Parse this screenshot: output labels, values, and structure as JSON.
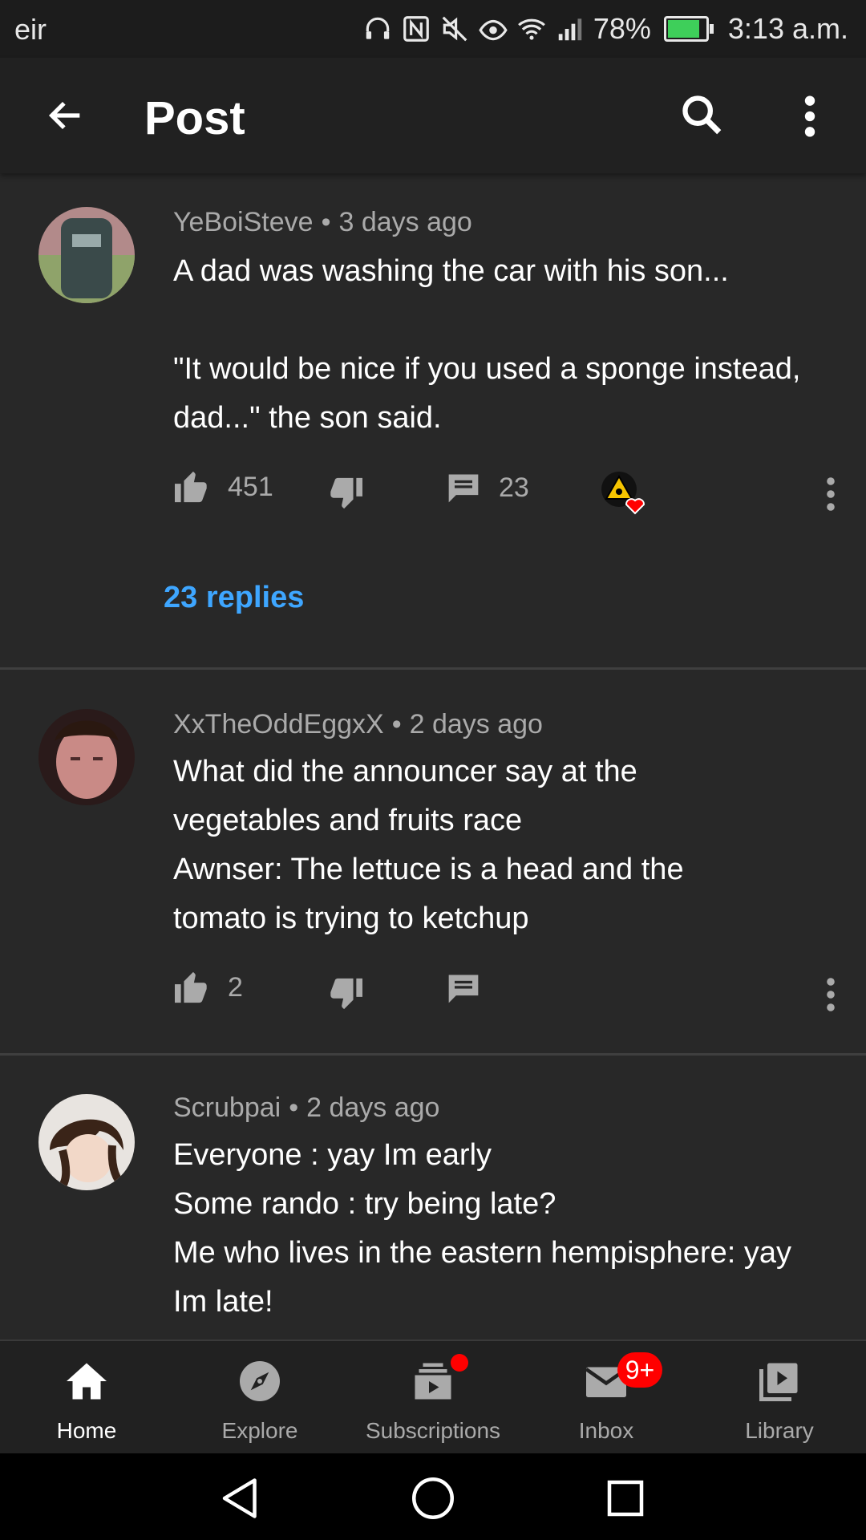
{
  "status_bar": {
    "carrier": "eir",
    "battery": "78%",
    "time": "3:13 a.m.",
    "icons": [
      "headphones-icon",
      "nfc-icon",
      "mute-icon",
      "eye-icon",
      "wifi-icon",
      "signal-icon",
      "battery-icon"
    ]
  },
  "app_bar": {
    "title": "Post",
    "icons": [
      "back-arrow-icon",
      "search-icon",
      "more-vert-icon"
    ]
  },
  "comments": [
    {
      "author": "YeBoiSteve",
      "sep": "•",
      "time": "3 days ago",
      "text": "A dad was washing the car with his son...\n\n\"It would be nice if you used a sponge instead, dad...\" the son said.",
      "likes": "451",
      "replies_count": "23",
      "replies_link": "23 replies"
    },
    {
      "author": "XxTheOddEggxX",
      "sep": "•",
      "time": "2 days ago",
      "text": "What did the announcer say at the vegetables and fruits race\nAwnser: The lettuce is a head and the tomato is trying to ketchup",
      "likes": "2"
    },
    {
      "author": "Scrubpai",
      "sep": "•",
      "time": "2 days ago",
      "text": "Everyone : yay Im early\nSome rando : try being late?\nMe who lives in the eastern hempisphere: yay Im late!"
    }
  ],
  "bottom_nav": {
    "items": [
      {
        "label": "Home",
        "icon": "home-icon",
        "active": true
      },
      {
        "label": "Explore",
        "icon": "compass-icon"
      },
      {
        "label": "Subscriptions",
        "icon": "subscriptions-icon"
      },
      {
        "label": "Inbox",
        "icon": "mail-icon",
        "badge": "9+"
      },
      {
        "label": "Library",
        "icon": "library-icon"
      }
    ]
  },
  "colors": {
    "background": "#282828",
    "appbar": "#212121",
    "link": "#3ea6ff",
    "badge": "#ff0000",
    "heart": "#ff0000"
  }
}
